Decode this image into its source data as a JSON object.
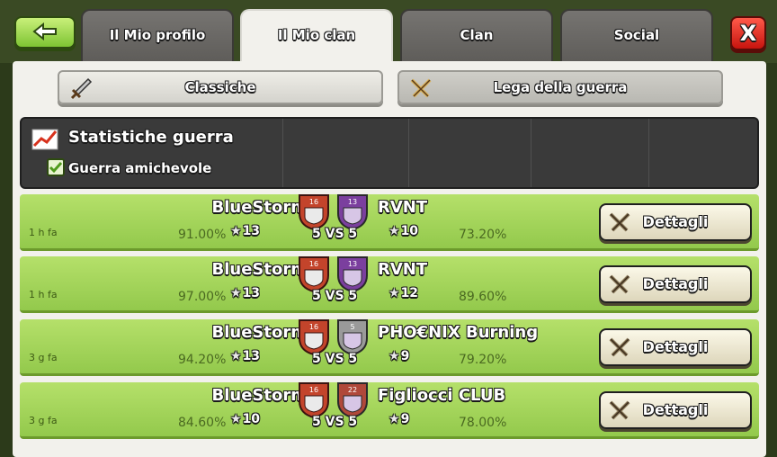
{
  "tabs": {
    "profile": "Il Mio profilo",
    "my_clan": "Il Mio clan",
    "clans": "Clan",
    "social": "Social"
  },
  "close_label": "X",
  "subtabs": {
    "classic": "Classiche",
    "cwl": "Lega della guerra"
  },
  "stats": {
    "title": "Statistiche guerra",
    "friendly": "Guerra amichevole"
  },
  "details_label": "Dettagli",
  "wars": [
    {
      "time": "1 h fa",
      "clan_a": "BlueStorm",
      "clan_b": "RVNT",
      "level_a": "16",
      "level_b": "13",
      "pct_a": "91.00%",
      "stars_a": "13",
      "stars_b": "10",
      "pct_b": "73.20%",
      "vs": "5 VS 5",
      "badge_b_color": "#7b3f9e"
    },
    {
      "time": "1 h fa",
      "clan_a": "BlueStorm",
      "clan_b": "RVNT",
      "level_a": "16",
      "level_b": "13",
      "pct_a": "97.00%",
      "stars_a": "13",
      "stars_b": "12",
      "pct_b": "89.60%",
      "vs": "5 VS 5",
      "badge_b_color": "#7b3f9e"
    },
    {
      "time": "3 g fa",
      "clan_a": "BlueStorm",
      "clan_b": "PHO€NIX Burning",
      "level_a": "16",
      "level_b": "5",
      "pct_a": "94.20%",
      "stars_a": "13",
      "stars_b": "9",
      "pct_b": "79.20%",
      "vs": "5 VS 5",
      "badge_b_color": "#9a9a9a"
    },
    {
      "time": "3 g fa",
      "clan_a": "BlueStorm",
      "clan_b": "Figliocci CLUB",
      "level_a": "16",
      "level_b": "22",
      "pct_a": "84.60%",
      "stars_a": "10",
      "stars_b": "9",
      "pct_b": "78.00%",
      "vs": "5 VS 5",
      "badge_b_color": "#b0483a"
    }
  ],
  "colors": {
    "row": "#a8d75c",
    "accent_red": "#c7140e",
    "accent_green": "#7ec433"
  }
}
